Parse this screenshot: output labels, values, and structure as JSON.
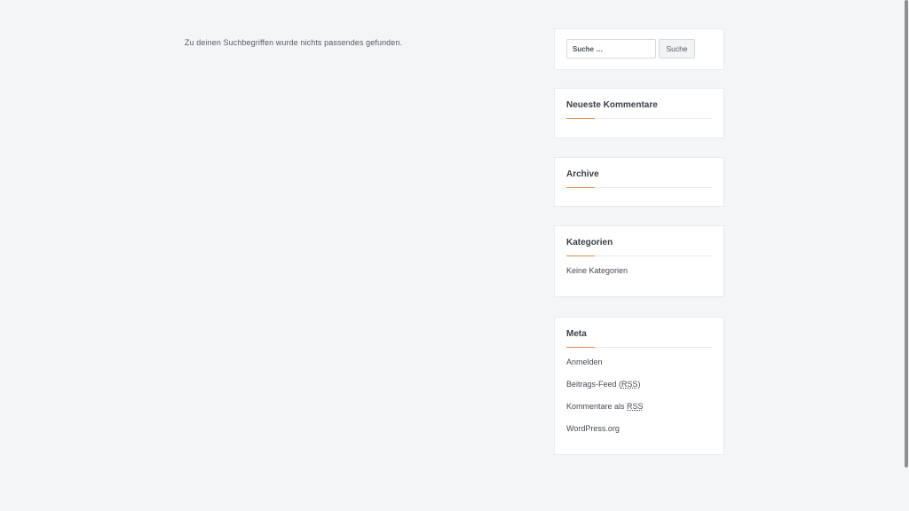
{
  "main": {
    "no_results_text": "Zu deinen Suchbegriffen wurde nichts passendes gefunden."
  },
  "sidebar": {
    "search": {
      "placeholder": "Suche …",
      "button_label": "Suche"
    },
    "recent_comments": {
      "title": "Neueste Kommentare"
    },
    "archive": {
      "title": "Archive"
    },
    "categories": {
      "title": "Kategorien",
      "items": [
        "Keine Kategorien"
      ]
    },
    "meta": {
      "title": "Meta",
      "links": {
        "login": "Anmelden",
        "entries_feed_prefix": "Beitrags-Feed (",
        "entries_feed_abbr": "RSS",
        "entries_feed_suffix": ")",
        "comments_feed_prefix": "Kommentare als ",
        "comments_feed_abbr": "RSS",
        "wordpress": "WordPress.org"
      }
    }
  },
  "colors": {
    "accent": "#e38b4f",
    "background": "#f4f5f7",
    "widget_background": "#ffffff"
  }
}
